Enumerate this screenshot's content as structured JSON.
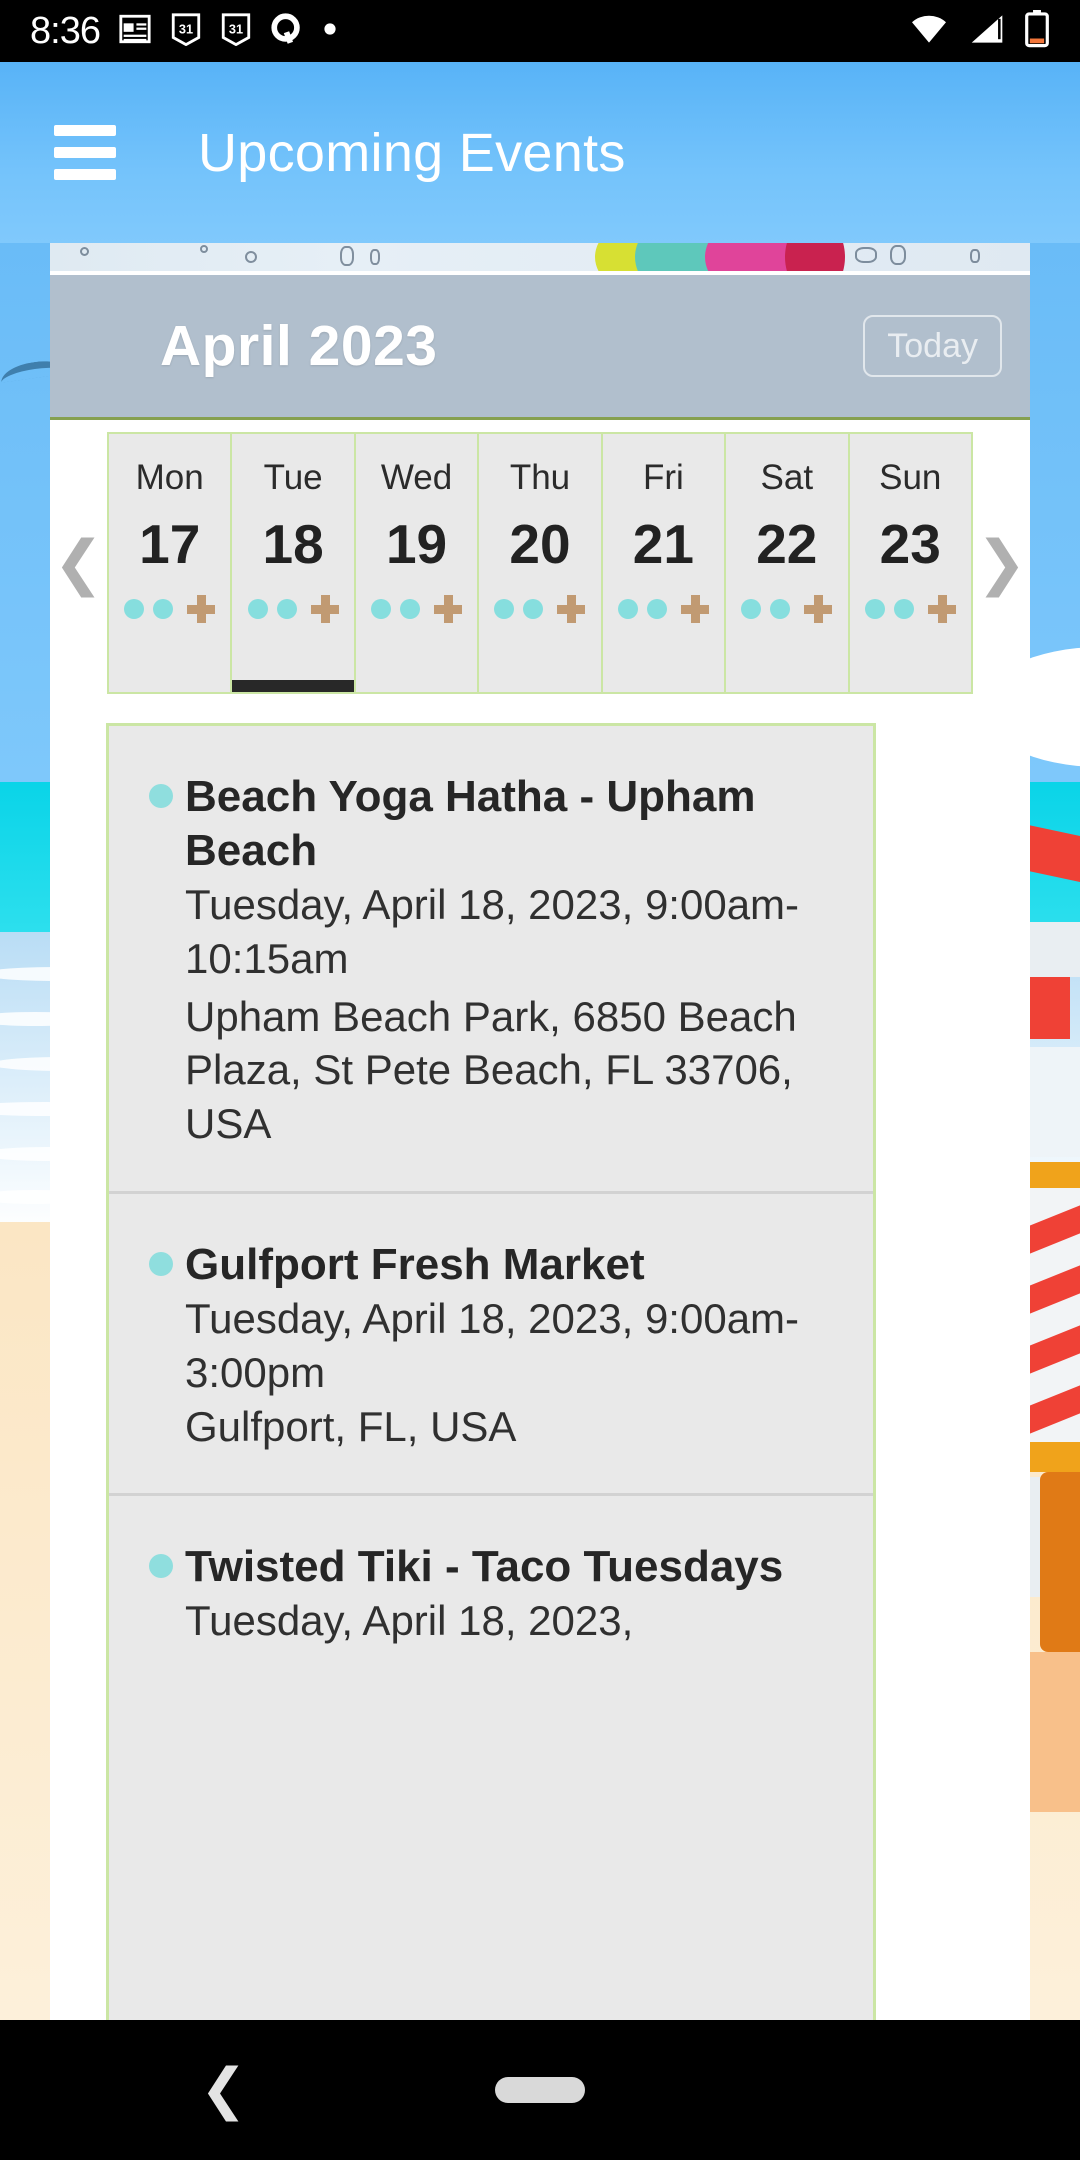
{
  "status_bar": {
    "time": "8:36",
    "left_icons": [
      "news-icon",
      "calendar-31-icon",
      "calendar-31-icon",
      "quora-q-icon",
      "dot-icon"
    ],
    "right_icons": [
      "wifi-icon",
      "cellular-signal-icon",
      "battery-low-icon"
    ]
  },
  "app_bar": {
    "menu_icon": "hamburger-menu-icon",
    "title": "Upcoming Events"
  },
  "month_banner": {
    "label": "April 2023",
    "today_label": "Today"
  },
  "week_strip": {
    "prev_arrow": "chevron-left-icon",
    "next_arrow": "chevron-right-icon",
    "selected_index": 1,
    "days": [
      {
        "name": "Mon",
        "num": "17",
        "dots": 2,
        "plus": true
      },
      {
        "name": "Tue",
        "num": "18",
        "dots": 2,
        "plus": true
      },
      {
        "name": "Wed",
        "num": "19",
        "dots": 2,
        "plus": true
      },
      {
        "name": "Thu",
        "num": "20",
        "dots": 2,
        "plus": true
      },
      {
        "name": "Fri",
        "num": "21",
        "dots": 2,
        "plus": true
      },
      {
        "name": "Sat",
        "num": "22",
        "dots": 2,
        "plus": true
      },
      {
        "name": "Sun",
        "num": "23",
        "dots": 2,
        "plus": true
      }
    ]
  },
  "events": [
    {
      "title": "Beach Yoga Hatha - Upham Beach",
      "datetime": "Tuesday, April 18, 2023, 9:00am-10:15am",
      "location": "Upham Beach Park, 6850 Beach Plaza, St Pete Beach, FL 33706, USA"
    },
    {
      "title": "Gulfport Fresh Market",
      "datetime": "Tuesday, April 18, 2023, 9:00am-3:00pm",
      "location": "Gulfport, FL, USA"
    },
    {
      "title": "Twisted Tiki - Taco Tuesdays",
      "datetime": "Tuesday, April 18, 2023,",
      "location": ""
    }
  ],
  "nav_bar": {
    "back_icon": "chevron-back-icon",
    "home_icon": "home-pill-icon"
  },
  "colors": {
    "app_bar_blue": "#74c3fb",
    "banner_gray": "#b1bfcd",
    "cell_bg": "#e9e9e9",
    "cell_border_green": "#cbe6a4",
    "dot_cyan": "#86dede",
    "plus_tan": "#c19a72",
    "selected_dark": "#282828",
    "sand": "#fbe6c4",
    "sea_cyan": "#0ad4e8"
  }
}
